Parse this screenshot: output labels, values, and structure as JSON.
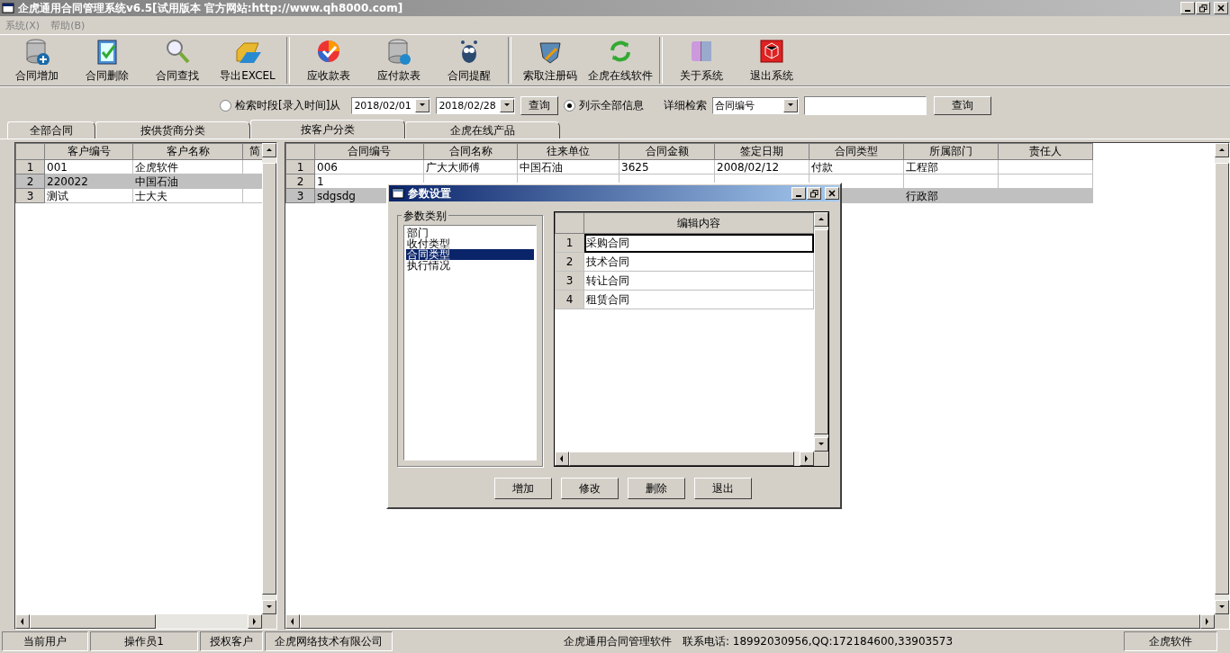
{
  "window": {
    "title": "企虎通用合同管理系统v6.5[试用版本 官方网站:http://www.qh8000.com]"
  },
  "menu": [
    {
      "label": "系统(X)"
    },
    {
      "label": "帮助(B)"
    }
  ],
  "toolbar": [
    [
      {
        "label": "合同增加"
      },
      {
        "label": "合同删除"
      },
      {
        "label": "合同查找"
      },
      {
        "label": "导出EXCEL"
      }
    ],
    [
      {
        "label": "应收款表"
      },
      {
        "label": "应付款表"
      },
      {
        "label": "合同提醒"
      }
    ],
    [
      {
        "label": "索取注册码"
      },
      {
        "label": "企虎在线软件"
      }
    ],
    [
      {
        "label": "关于系统"
      },
      {
        "label": "退出系统"
      }
    ]
  ],
  "search": {
    "period": {
      "label": "检索时段[录入时间]从",
      "selected": false
    },
    "date_from": "2018/02/01",
    "date_to": "2018/02/28",
    "query_button": "查询",
    "all": {
      "label": "列示全部信息",
      "selected": true
    },
    "detail_label": "详细检索",
    "detail_field": "合同编号",
    "detail_button": "查询"
  },
  "tabs": [
    {
      "label": "全部合同",
      "selected": false
    },
    {
      "label": "按供货商分类",
      "selected": false
    },
    {
      "label": "按客户分类",
      "selected": true
    },
    {
      "label": "企虎在线产品",
      "selected": false
    }
  ],
  "customers": {
    "columns": [
      "客户编号",
      "客户名称",
      "简"
    ],
    "rows": [
      {
        "num": "1",
        "cells": [
          "001",
          "企虎软件",
          null
        ],
        "selected": false
      },
      {
        "num": "2",
        "cells": [
          "220022",
          "中国石油",
          null
        ],
        "selected": true
      },
      {
        "num": "3",
        "cells": [
          "测试",
          "士大夫",
          null
        ],
        "selected": false
      }
    ]
  },
  "contracts": {
    "columns": [
      "合同编号",
      "合同名称",
      "往来单位",
      "合同金额",
      "签定日期",
      "合同类型",
      "所属部门",
      "责任人"
    ],
    "rows": [
      {
        "num": "1",
        "cells": [
          "006",
          "广大大师傅",
          "中国石油",
          "3625",
          "2008/02/12",
          "付款",
          "工程部",
          null
        ],
        "selected": false
      },
      {
        "num": "2",
        "cells": [
          "1",
          null,
          null,
          null,
          null,
          null,
          null,
          null
        ],
        "selected": false
      },
      {
        "num": "3",
        "cells": [
          "sdgsdg",
          null,
          null,
          null,
          null,
          null,
          "行政部",
          null
        ],
        "selected": true
      }
    ]
  },
  "dialog": {
    "title": "参数设置",
    "group_label": "参数类别",
    "categories": [
      {
        "label": "部门",
        "selected": false
      },
      {
        "label": "收付类型",
        "selected": false
      },
      {
        "label": "合同类型",
        "selected": true
      },
      {
        "label": "执行情况",
        "selected": false
      }
    ],
    "grid_header": "编辑内容",
    "rows": [
      {
        "num": "1",
        "text": "采购合同",
        "selected": true
      },
      {
        "num": "2",
        "text": "技术合同",
        "selected": false
      },
      {
        "num": "3",
        "text": "转让合同",
        "selected": false
      },
      {
        "num": "4",
        "text": "租赁合同",
        "selected": false
      }
    ],
    "buttons": [
      "增加",
      "修改",
      "删除",
      "退出"
    ]
  },
  "status_bar": {
    "left": [
      "当前用户",
      "操作员1",
      "授权客户",
      "企虎网络技术有限公司"
    ],
    "center": [
      "企虎通用合同管理软件",
      "联系电话: 18992030956,QQ:172184600,33903573"
    ],
    "right": "企虎软件"
  }
}
